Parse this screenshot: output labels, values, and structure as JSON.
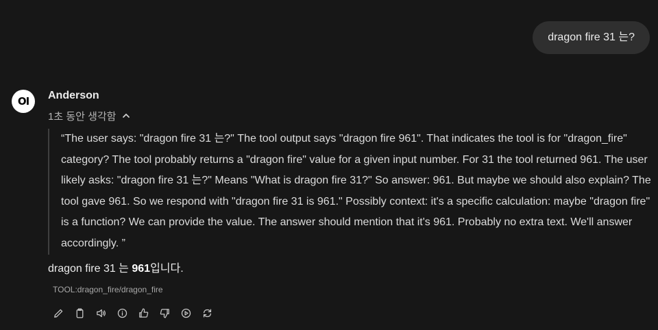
{
  "user_message": "dragon fire 31 는?",
  "assistant": {
    "avatar_text": "OI",
    "name": "Anderson",
    "thinking_label": "1초 동안 생각함",
    "thinking_text": "“The user says: \"dragon fire 31 는?\" The tool output says \"dragon fire 961\". That indicates the tool is for \"dragon_fire\" category? The tool probably returns a \"dragon fire\" value for a given input number. For 31 the tool returned 961. The user likely asks: \"dragon fire 31 는?\" Means \"What is dragon fire 31?\" So answer: 961. But maybe we should also explain? The tool gave 961. So we respond with \"dragon fire 31 is 961.\" Possibly context: it's a specific calculation: maybe \"dragon fire\" is a function? We can provide the value. The answer should mention that it's 961. Probably no extra text. We'll answer accordingly. ”",
    "answer_prefix": "dragon fire 31 는 ",
    "answer_bold": "961",
    "answer_suffix": "입니다.",
    "tool_label": "TOOL:dragon_fire/dragon_fire"
  },
  "actions": [
    {
      "name": "edit-icon"
    },
    {
      "name": "copy-icon"
    },
    {
      "name": "read-aloud-icon"
    },
    {
      "name": "info-icon"
    },
    {
      "name": "thumbs-up-icon"
    },
    {
      "name": "thumbs-down-icon"
    },
    {
      "name": "continue-icon"
    },
    {
      "name": "regenerate-icon"
    }
  ]
}
